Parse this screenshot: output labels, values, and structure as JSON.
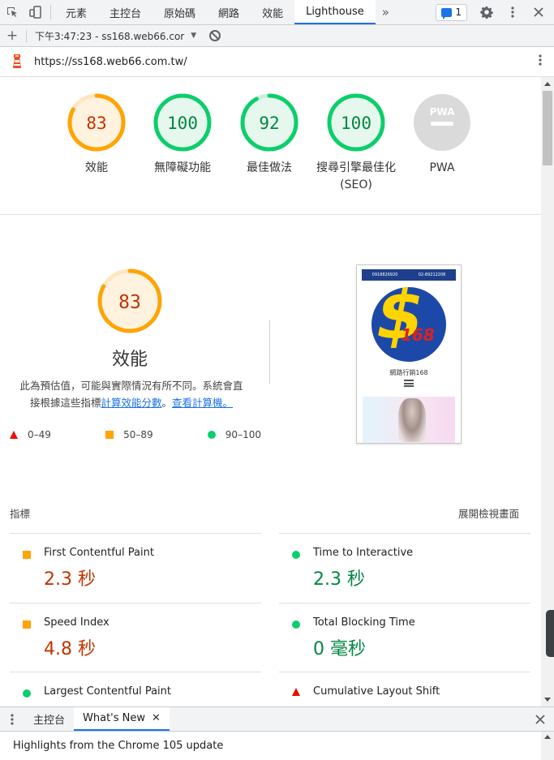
{
  "devtools": {
    "tabs": [
      {
        "label": "元素"
      },
      {
        "label": "主控台"
      },
      {
        "label": "原始碼"
      },
      {
        "label": "網路"
      },
      {
        "label": "效能"
      },
      {
        "label": "Lighthouse",
        "active": true
      }
    ],
    "more_tabs_glyph": "»",
    "issues_count": "1"
  },
  "toolbar": {
    "report_selector": "下午3:47:23 - ss168.web66.cor"
  },
  "url": "https://ss168.web66.com.tw/",
  "gauges": [
    {
      "score": "83",
      "label": "效能",
      "status": "average"
    },
    {
      "score": "100",
      "label": "無障礙功能",
      "status": "pass"
    },
    {
      "score": "92",
      "label": "最佳做法",
      "status": "pass"
    },
    {
      "score": "100",
      "label": "搜尋引擎最佳化",
      "label2": "(SEO)",
      "status": "pass"
    },
    {
      "score": "",
      "label": "PWA",
      "badge_text": "PWA",
      "status": "na"
    }
  ],
  "performance": {
    "score": "83",
    "title": "效能",
    "desc_line1": "此為預估值，可能與實際情況有所不同。系統會直",
    "desc_line2_prefix": "接根據這些指標",
    "link_calc": "計算效能分數",
    "desc_sep": "。",
    "link_calculator": "查看計算機。",
    "legend": [
      {
        "range": "0–49",
        "shape": "triangle"
      },
      {
        "range": "50–89",
        "shape": "square"
      },
      {
        "range": "90–100",
        "shape": "circle"
      }
    ]
  },
  "thumbnail": {
    "phone": "0918826920",
    "tel": "02-89212208",
    "logo_symbol": "$",
    "logo_number": "168",
    "site_name": "網路行銷168"
  },
  "metrics_header": {
    "left": "指標",
    "right": "展開檢視畫面"
  },
  "metrics": [
    {
      "name": "First Contentful Paint",
      "value": "2.3 秒",
      "status": "average"
    },
    {
      "name": "Time to Interactive",
      "value": "2.3 秒",
      "status": "pass"
    },
    {
      "name": "Speed Index",
      "value": "4.8 秒",
      "status": "average"
    },
    {
      "name": "Total Blocking Time",
      "value": "0 毫秒",
      "status": "pass"
    },
    {
      "name": "Largest Contentful Paint",
      "value": "",
      "status": "pass"
    },
    {
      "name": "Cumulative Layout Shift",
      "value": "",
      "status": "fail"
    }
  ],
  "drawer": {
    "tabs": [
      {
        "label": "主控台"
      },
      {
        "label": "What's New",
        "active": true
      }
    ],
    "message": "Highlights from the Chrome 105 update"
  },
  "colors": {
    "pass": "#0cce6b",
    "average": "#ffa400",
    "fail": "#eb0f00",
    "accent": "#1a73e8"
  }
}
